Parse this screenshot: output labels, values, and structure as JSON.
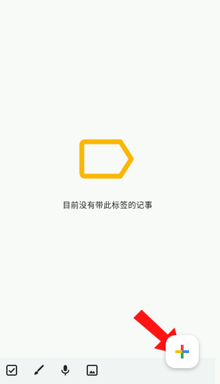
{
  "empty_state": {
    "message": "目前没有带此标签的记事",
    "icon": "label-outline-icon",
    "icon_color": "#f9b700"
  },
  "bottom_bar": {
    "items": [
      {
        "icon": "checkbox-icon"
      },
      {
        "icon": "brush-icon"
      },
      {
        "icon": "microphone-icon"
      },
      {
        "icon": "image-icon"
      }
    ],
    "background": "#f0f4f3"
  },
  "fab": {
    "icon": "plus-icon",
    "colors": [
      "#ea4335",
      "#4285f4",
      "#34a853",
      "#fbbc05"
    ]
  },
  "annotation": {
    "icon": "red-arrow-icon",
    "color": "#ff1414"
  }
}
